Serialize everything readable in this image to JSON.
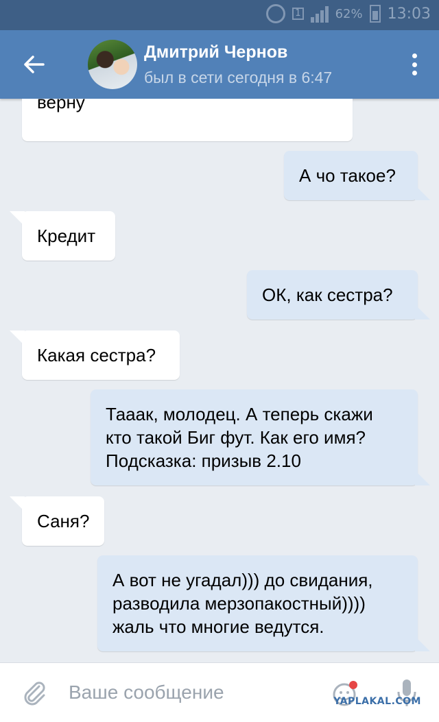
{
  "status_bar": {
    "battery": "62%",
    "time": "13:03",
    "sim_label": "1"
  },
  "header": {
    "back_icon": "arrow-left-icon",
    "contact_name": "Дмитрий Чернов",
    "contact_status": "был в сети сегодня в 6:47",
    "menu_icon": "more-vertical-icon"
  },
  "messages": [
    {
      "direction": "in",
      "lines": [
        "верну"
      ]
    },
    {
      "direction": "out",
      "lines": [
        "А чо такое?"
      ]
    },
    {
      "direction": "in",
      "lines": [
        "Кредит"
      ]
    },
    {
      "direction": "out",
      "lines": [
        "ОК, как сестра?"
      ]
    },
    {
      "direction": "in",
      "lines": [
        "Какая сестра?"
      ]
    },
    {
      "direction": "out",
      "lines": [
        "Тааак, молодец. А теперь скажи",
        "кто такой Биг фут. Как его имя?",
        "Подсказка: призыв 2.10"
      ]
    },
    {
      "direction": "in",
      "lines": [
        "Саня?"
      ]
    },
    {
      "direction": "out",
      "lines": [
        "А вот не угадал))) до свидания,",
        "разводила мерзопакостный))))",
        "жаль что многие ведутся."
      ]
    }
  ],
  "composer": {
    "placeholder": "Ваше сообщение",
    "attach_icon": "paperclip-icon",
    "sticker_icon": "sticker-icon",
    "mic_icon": "microphone-icon"
  },
  "watermark": "YAPLAKAL.COM",
  "colors": {
    "header_bg": "#5181b8",
    "status_bar_bg": "#3e5f86",
    "chat_bg": "#e9edf2",
    "bubble_in": "#ffffff",
    "bubble_out": "#dbe7f5",
    "sticker_badge": "#e64646"
  }
}
